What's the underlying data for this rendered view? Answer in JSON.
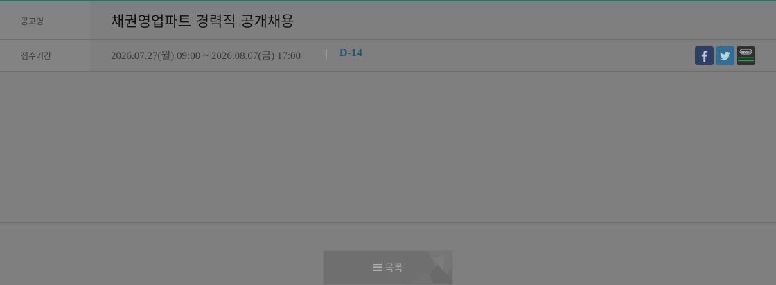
{
  "notice": {
    "title_label": "공고명",
    "title": "채권영업파트 경력직 공개채용",
    "period_label": "접수기간",
    "period": "2026.07.27(월) 09:00 ~ 2026.08.07(금) 17:00",
    "d_day": "D-14"
  },
  "share": {
    "icons": [
      "facebook-icon",
      "twitter-icon",
      "band-icon"
    ],
    "band_text": "BAND",
    "colors": {
      "facebook": "#2e3f66",
      "twitter": "#2f6f95",
      "band": "#2f2f2f",
      "band_stripe": "#2f9e4a"
    }
  },
  "actions": {
    "list_label": "목록"
  },
  "colors": {
    "accent": "#1b5c6b",
    "top_border": "#2a6f6c"
  }
}
